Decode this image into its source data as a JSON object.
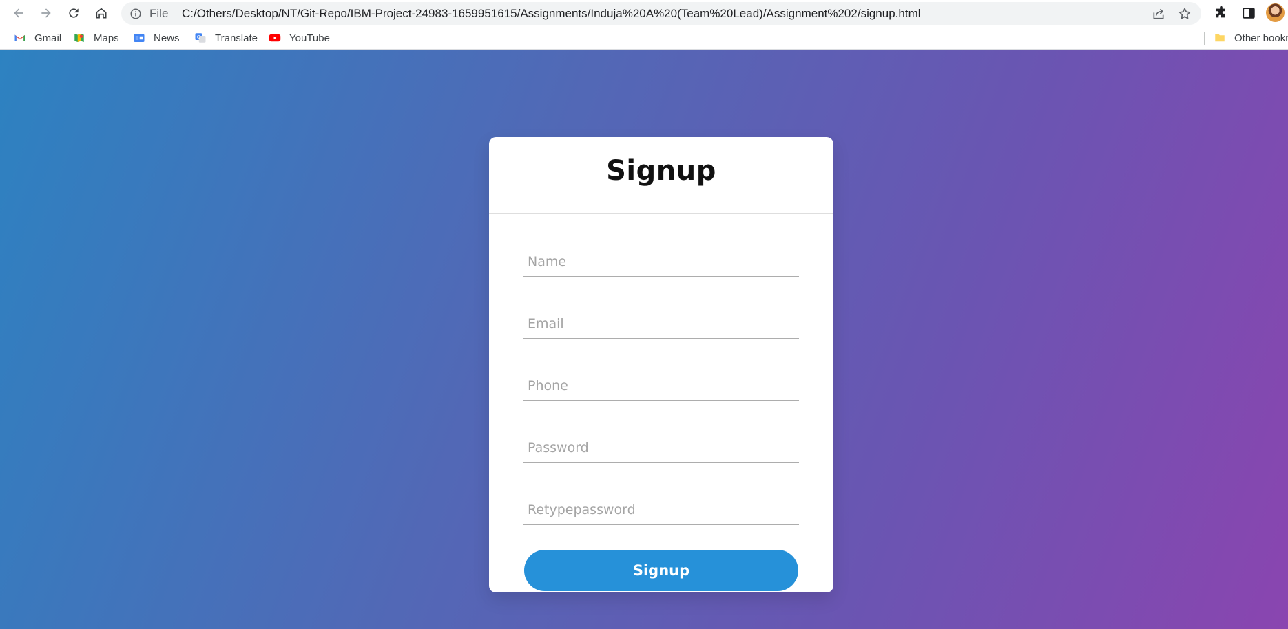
{
  "browser": {
    "omnibox": {
      "scheme_label": "File",
      "url": "C:/Others/Desktop/NT/Git-Repo/IBM-Project-24983-1659951615/Assignments/Induja%20A%20(Team%20Lead)/Assignment%202/signup.html"
    },
    "bookmarks": [
      {
        "label": "Gmail",
        "icon": "gmail-icon"
      },
      {
        "label": "Maps",
        "icon": "maps-icon"
      },
      {
        "label": "News",
        "icon": "news-icon"
      },
      {
        "label": "Translate",
        "icon": "translate-icon"
      },
      {
        "label": "YouTube",
        "icon": "youtube-icon"
      }
    ],
    "other_bookmarks_label": "Other bookm"
  },
  "form": {
    "title": "Signup",
    "fields": [
      {
        "placeholder": "Name",
        "value": ""
      },
      {
        "placeholder": "Email",
        "value": ""
      },
      {
        "placeholder": "Phone",
        "value": ""
      },
      {
        "placeholder": "Password",
        "value": ""
      },
      {
        "placeholder": "Retypepassword",
        "value": ""
      }
    ],
    "submit_label": "Signup"
  },
  "colors": {
    "gradient_start": "#2d82c1",
    "gradient_end": "#8a45b0",
    "button": "#2691d9"
  }
}
